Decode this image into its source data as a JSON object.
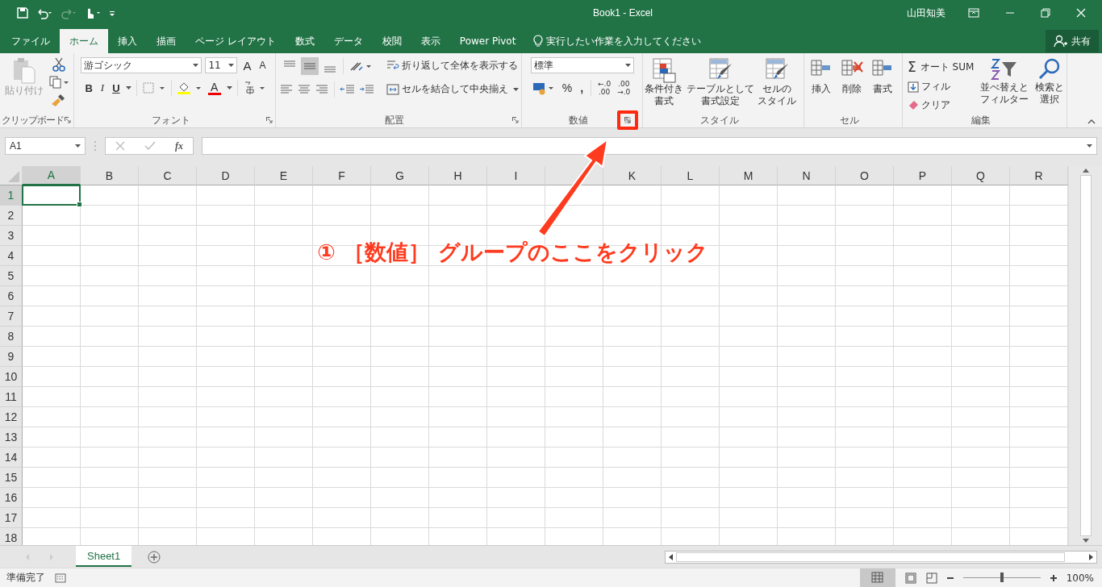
{
  "window": {
    "title": "Book1 - Excel",
    "user": "山田知美"
  },
  "tabs": [
    {
      "label": "ファイル",
      "selected": false
    },
    {
      "label": "ホーム",
      "selected": true
    },
    {
      "label": "挿入",
      "selected": false
    },
    {
      "label": "描画",
      "selected": false
    },
    {
      "label": "ページ レイアウト",
      "selected": false
    },
    {
      "label": "数式",
      "selected": false
    },
    {
      "label": "データ",
      "selected": false
    },
    {
      "label": "校閲",
      "selected": false
    },
    {
      "label": "表示",
      "selected": false
    },
    {
      "label": "Power Pivot",
      "selected": false
    }
  ],
  "tell_me": {
    "placeholder": "実行したい作業を入力してください"
  },
  "share": "共有",
  "ribbon": {
    "clipboard": {
      "paste": "貼り付け",
      "label": "クリップボード"
    },
    "font": {
      "font_name": "游ゴシック",
      "font_size": "11",
      "grow": "A",
      "shrink": "A",
      "bold": "B",
      "italic": "I",
      "underline": "U",
      "font_color": "A",
      "label": "フォント"
    },
    "alignment": {
      "wrap": "折り返して全体を表示する",
      "merge": "セルを結合して中央揃え",
      "label": "配置"
    },
    "number": {
      "format": "標準",
      "percent": "%",
      "comma": ",",
      "increase_decimal": [
        "←.0",
        ".00"
      ],
      "decrease_decimal": [
        ".00",
        "→.0"
      ],
      "label": "数値"
    },
    "styles": {
      "buttons": [
        {
          "lines": [
            "条件付き",
            "書式"
          ]
        },
        {
          "lines": [
            "テーブルとして",
            "書式設定"
          ]
        },
        {
          "lines": [
            "セルの",
            "スタイル"
          ]
        }
      ],
      "label": "スタイル"
    },
    "cells": {
      "buttons": [
        {
          "label": "挿入",
          "kind": "insert"
        },
        {
          "label": "削除",
          "kind": "delete"
        },
        {
          "label": "書式",
          "kind": "format"
        }
      ],
      "label": "セル"
    },
    "editing": {
      "sigma": "Σ",
      "autosum": "オート SUM",
      "fill": "フィル",
      "clear": "クリア",
      "sort": [
        "並べ替えと",
        "フィルター"
      ],
      "find": [
        "検索と",
        "選択"
      ],
      "label": "編集"
    }
  },
  "formula_bar": {
    "name_box": "A1",
    "fx": "fx"
  },
  "columns": [
    {
      "label": "A",
      "selected": true
    },
    {
      "label": "B",
      "selected": false
    },
    {
      "label": "C",
      "selected": false
    },
    {
      "label": "D",
      "selected": false
    },
    {
      "label": "E",
      "selected": false
    },
    {
      "label": "F",
      "selected": false
    },
    {
      "label": "G",
      "selected": false
    },
    {
      "label": "H",
      "selected": false
    },
    {
      "label": "I",
      "selected": false
    },
    {
      "selected": false
    },
    {
      "label": "K",
      "selected": false
    },
    {
      "label": "L",
      "selected": false
    },
    {
      "label": "M",
      "selected": false
    },
    {
      "label": "N",
      "selected": false
    },
    {
      "label": "O",
      "selected": false
    },
    {
      "label": "P",
      "selected": false
    },
    {
      "label": "Q",
      "selected": false
    },
    {
      "label": "R",
      "selected": false
    }
  ],
  "rows": [
    {
      "label": "1",
      "selected": true
    },
    {
      "label": "2",
      "selected": false
    },
    {
      "label": "3",
      "selected": false
    },
    {
      "label": "4",
      "selected": false
    },
    {
      "label": "5",
      "selected": false
    },
    {
      "label": "6",
      "selected": false
    },
    {
      "label": "7",
      "selected": false
    },
    {
      "label": "8",
      "selected": false
    },
    {
      "label": "9",
      "selected": false
    },
    {
      "label": "10",
      "selected": false
    },
    {
      "label": "11",
      "selected": false
    },
    {
      "label": "12",
      "selected": false
    },
    {
      "label": "13",
      "selected": false
    },
    {
      "label": "14",
      "selected": false
    },
    {
      "label": "15",
      "selected": false
    },
    {
      "label": "16",
      "selected": false
    },
    {
      "label": "17",
      "selected": false
    },
    {
      "label": "18",
      "selected": false
    }
  ],
  "sheets": [
    {
      "label": "Sheet1",
      "selected": true
    }
  ],
  "status_bar": {
    "status": "準備完了",
    "zoom": "100%",
    "zoom_slider": {
      "level": 0.5
    }
  },
  "callout": {
    "text": "① ［数値］ グループのここをクリック"
  }
}
